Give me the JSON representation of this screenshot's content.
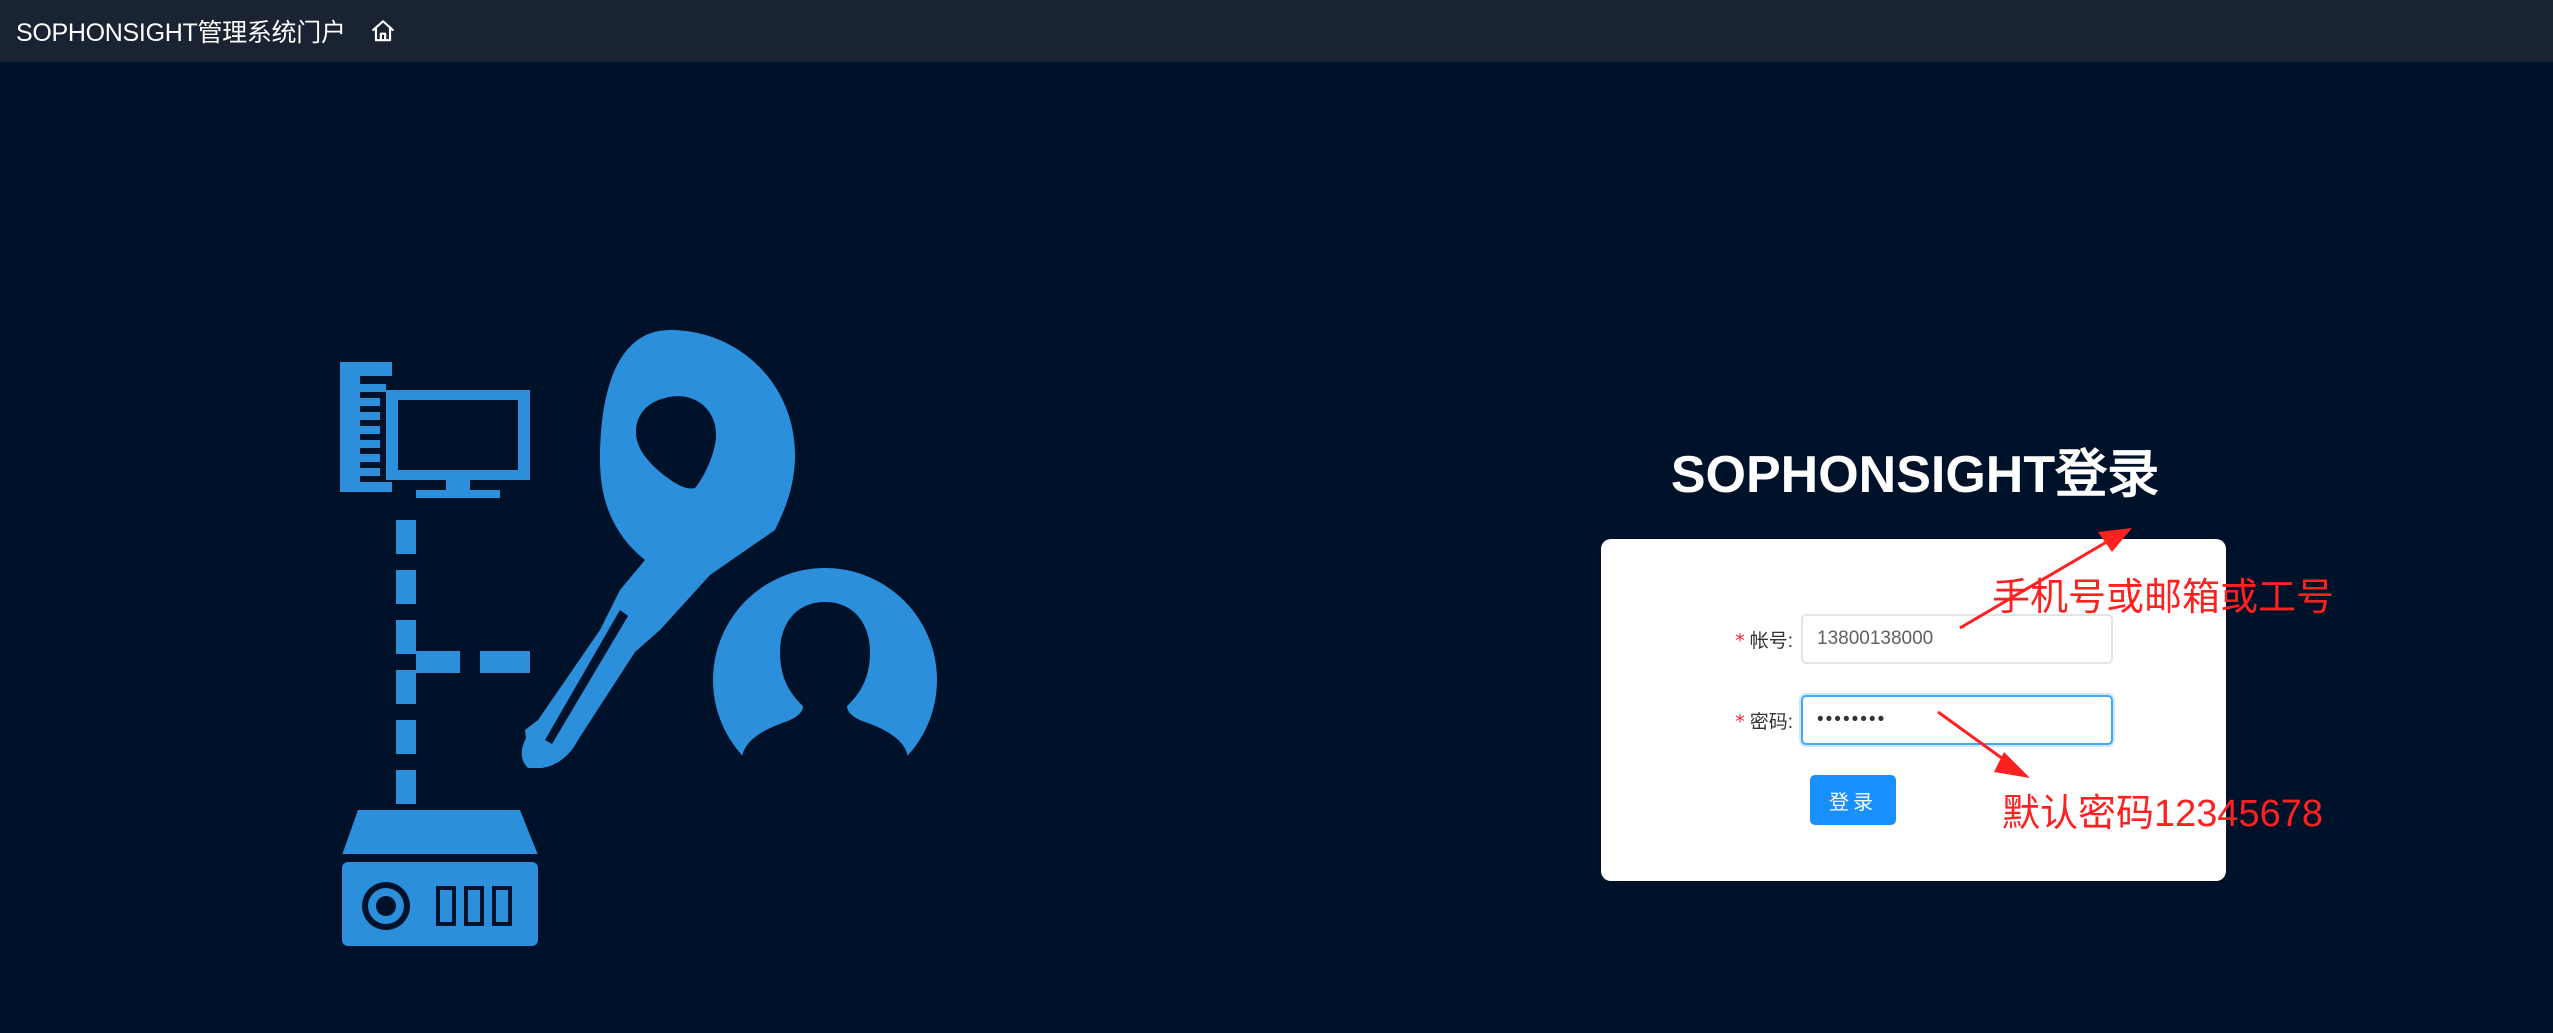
{
  "header": {
    "title": "SOPHONSIGHT管理系统门户",
    "home_icon": "home-icon"
  },
  "login": {
    "title": "SOPHONSIGHT登录",
    "account_label": "帐号:",
    "account_value": "13800138000",
    "password_label": "密码:",
    "password_value": "12345678",
    "required_mark": "*",
    "submit_label": "登录"
  },
  "annotations": {
    "account_hint": "手机号或邮箱或工号",
    "password_hint": "默认密码12345678"
  },
  "colors": {
    "background": "#00112a",
    "topbar": "#1a2332",
    "illustration": "#2b8fdb",
    "primary_button": "#1890ff",
    "annotation": "#ff2020",
    "required": "#f5222d"
  }
}
